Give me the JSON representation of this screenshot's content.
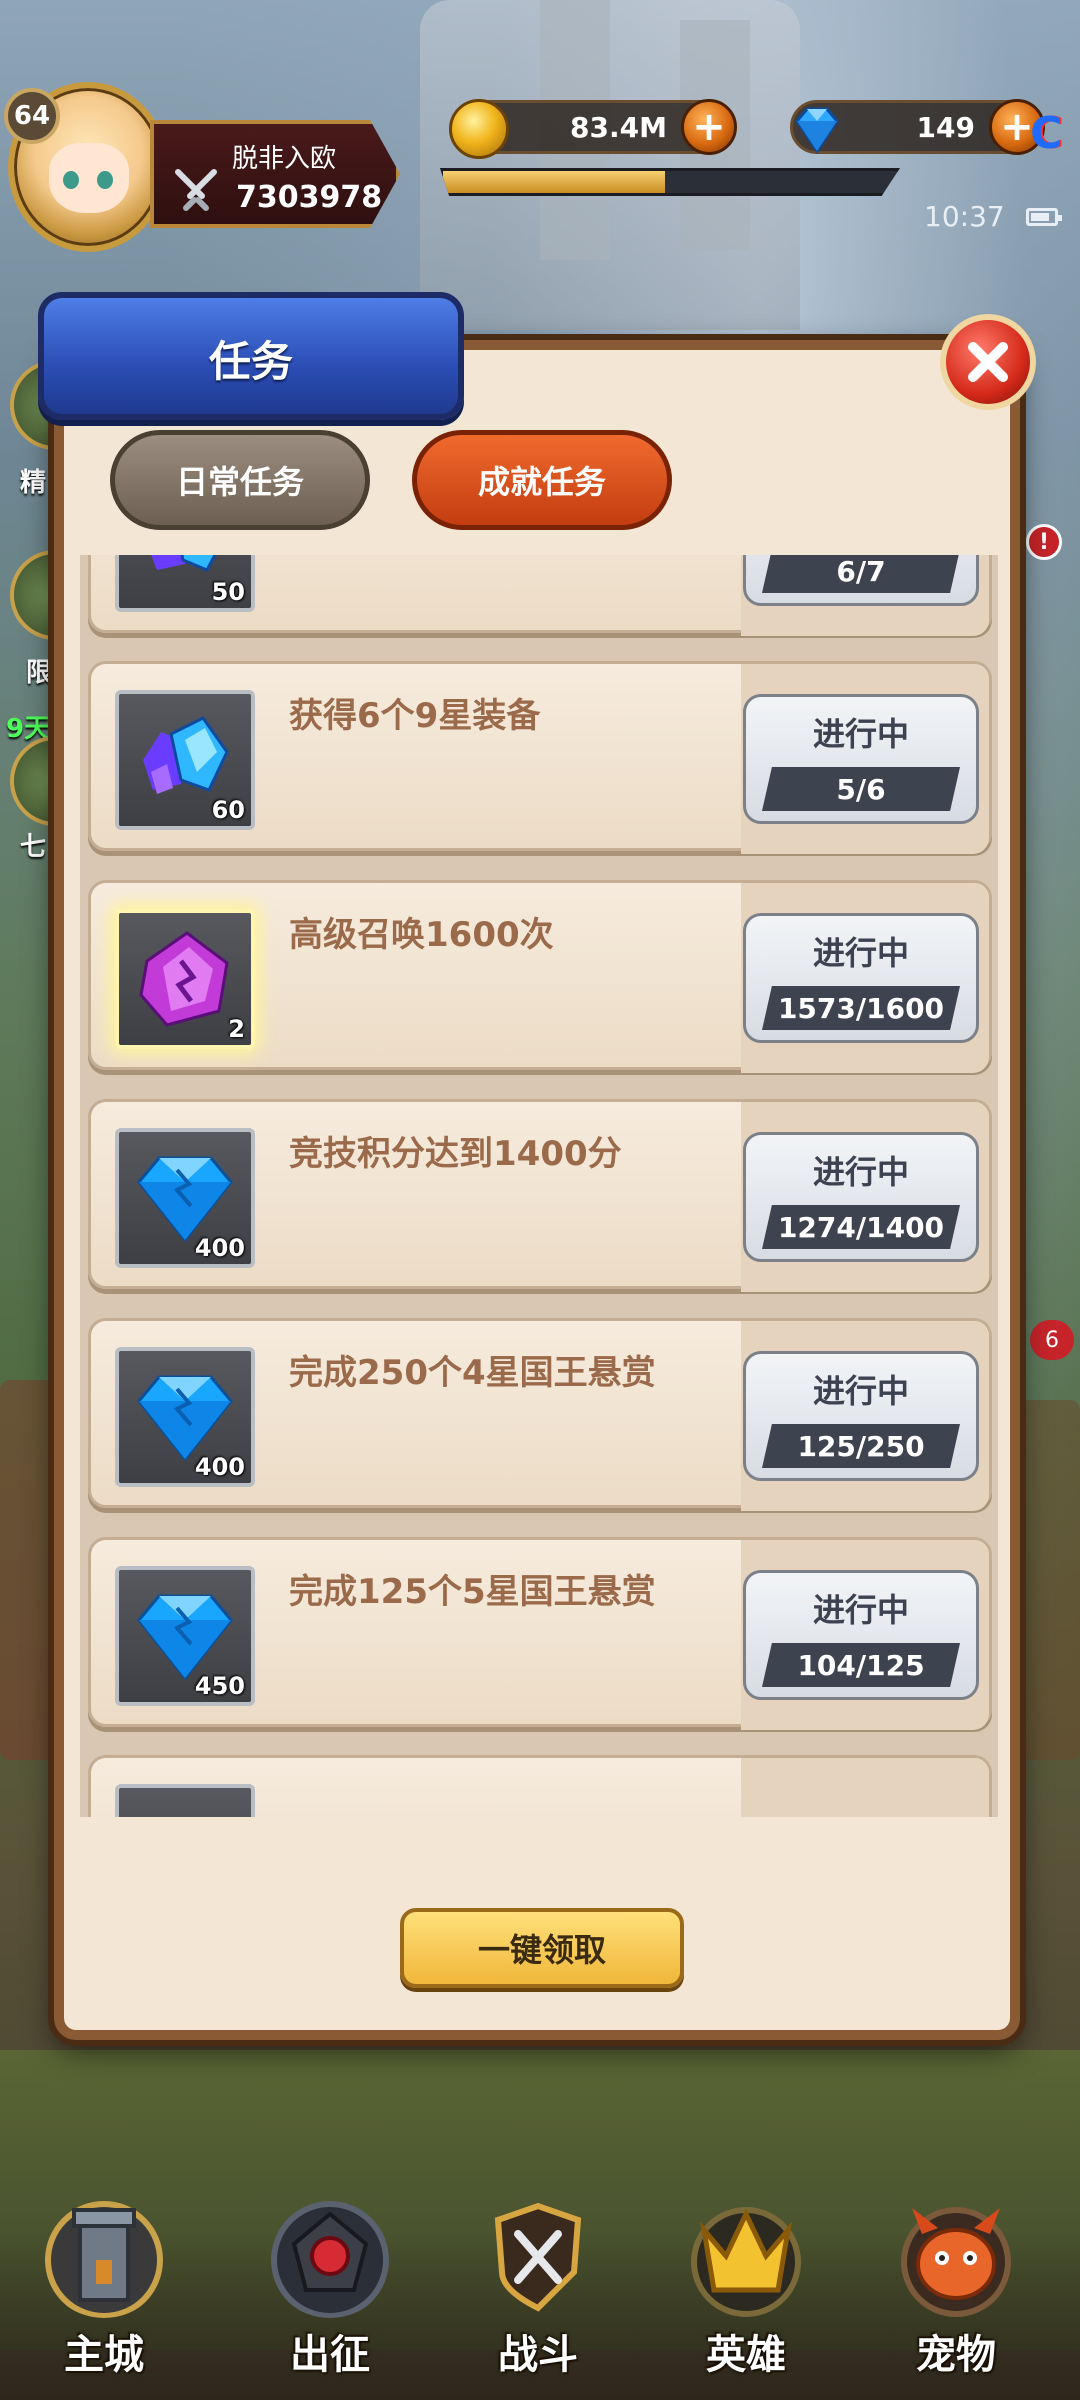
{
  "hud": {
    "level": "64",
    "player_name": "脱非入欧",
    "power": "7303978",
    "gold": "83.4M",
    "gems": "149",
    "exp_fraction": 0.49,
    "clock": "10:37",
    "brand_mark": "C"
  },
  "side": {
    "left_peek_1": "精",
    "left_peek_2": "限",
    "left_peek_3": "9天",
    "left_peek_4": "七",
    "badge_count": "6",
    "alert_mark": "!"
  },
  "dialog": {
    "title": "任务",
    "tabs": [
      {
        "label": "日常任务",
        "active": false
      },
      {
        "label": "成就任务",
        "active": true
      }
    ],
    "tasks": [
      {
        "icon": "crystal-cluster-icon",
        "count": "50",
        "desc": "",
        "status": "",
        "progress": "6/7"
      },
      {
        "icon": "crystal-cluster-icon",
        "count": "60",
        "desc": "获得6个9星装备",
        "status": "进行中",
        "progress": "5/6"
      },
      {
        "icon": "purple-summon-crystal-icon",
        "count": "2",
        "desc": "高级召唤1600次",
        "status": "进行中",
        "progress": "1573/1600"
      },
      {
        "icon": "blue-diamond-icon",
        "count": "400",
        "desc": "竞技积分达到1400分",
        "status": "进行中",
        "progress": "1274/1400"
      },
      {
        "icon": "blue-diamond-icon",
        "count": "400",
        "desc": "完成250个4星国王悬赏",
        "status": "进行中",
        "progress": "125/250"
      },
      {
        "icon": "blue-diamond-icon",
        "count": "450",
        "desc": "完成125个5星国王悬赏",
        "status": "进行中",
        "progress": "104/125"
      }
    ],
    "claim_all": "一键领取"
  },
  "nav": [
    {
      "label": "主城",
      "icon": "castle-tower-icon"
    },
    {
      "label": "出征",
      "icon": "expedition-gem-icon"
    },
    {
      "label": "战斗",
      "icon": "crossed-swords-shield-icon"
    },
    {
      "label": "英雄",
      "icon": "hero-crown-icon"
    },
    {
      "label": "宠物",
      "icon": "dragon-pet-icon"
    }
  ],
  "colors": {
    "accent_orange": "#c33d10",
    "title_blue": "#2b4db4",
    "panel_bg": "#f4e6d4",
    "task_text": "#9b6a4a"
  }
}
